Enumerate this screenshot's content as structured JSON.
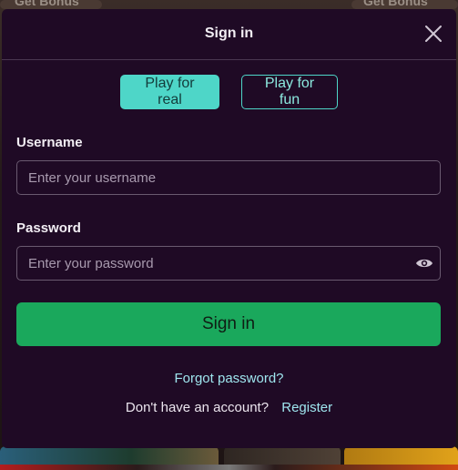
{
  "backdrop": {
    "bonus_left": "Get Bonus",
    "bonus_right": "Get Bonus"
  },
  "modal": {
    "title": "Sign in",
    "close_icon": "close-icon",
    "modes": {
      "real_label": "Play for real",
      "fun_label": "Play for fun",
      "selected": "real"
    },
    "username": {
      "label": "Username",
      "placeholder": "Enter your username",
      "value": ""
    },
    "password": {
      "label": "Password",
      "placeholder": "Enter your password",
      "value": "",
      "toggle_icon": "eye-icon"
    },
    "submit_label": "Sign in",
    "forgot_label": "Forgot password?",
    "register_prompt": "Don't have an account?",
    "register_label": "Register"
  },
  "colors": {
    "modal_bg": "#1f0a25",
    "accent_teal": "#4ed6c8",
    "submit_green": "#1aa85c",
    "link": "#9fe6ef"
  }
}
